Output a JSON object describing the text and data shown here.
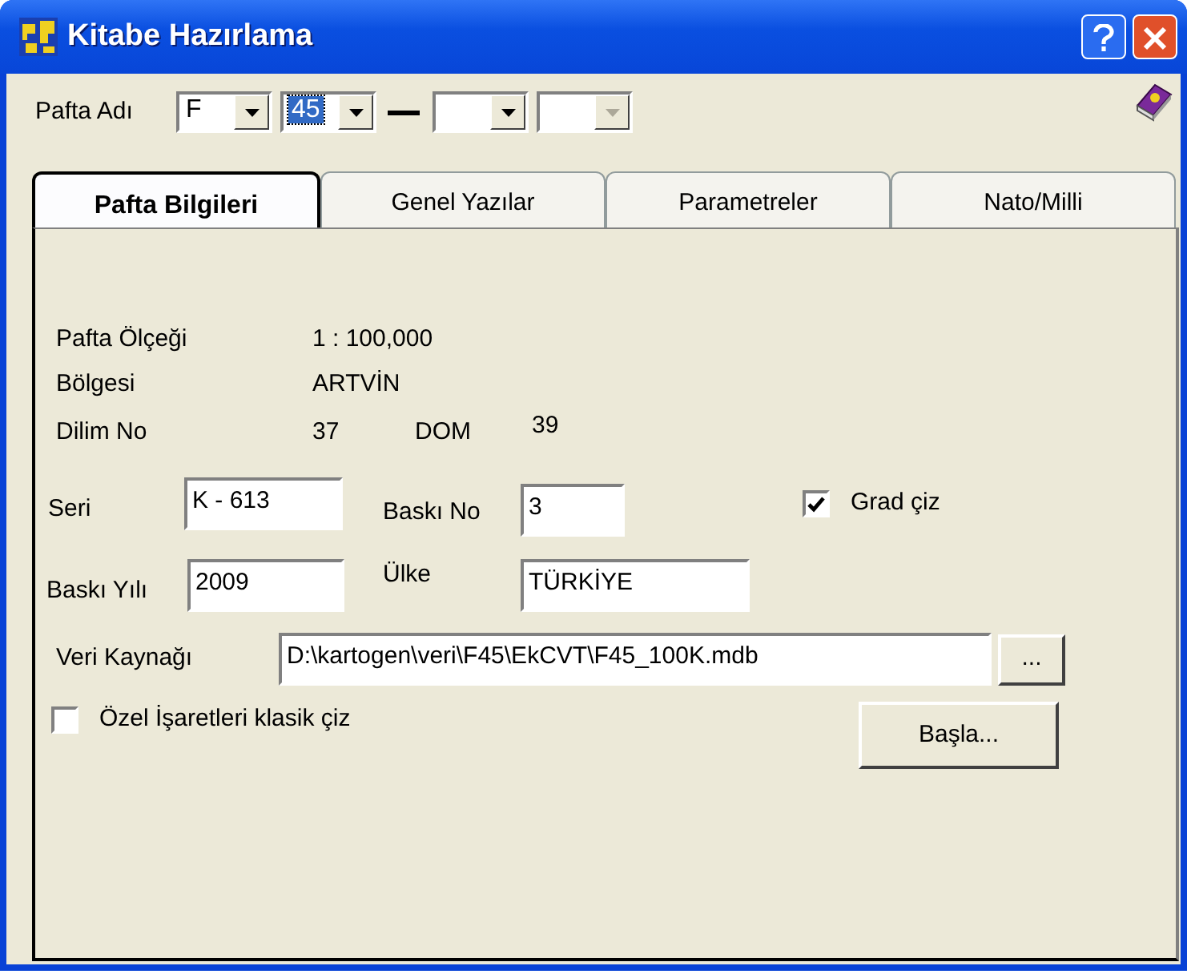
{
  "window": {
    "title": "Kitabe Hazırlama"
  },
  "pafta_adi": {
    "label": "Pafta Adı",
    "combos": [
      {
        "value": "F",
        "focused": false,
        "disabled": false
      },
      {
        "value": "45",
        "focused": true,
        "disabled": false
      },
      {
        "focused": false,
        "disabled": false
      },
      {
        "focused": false,
        "disabled": true
      }
    ]
  },
  "tabs": [
    {
      "label": "Pafta Bilgileri",
      "selected": true
    },
    {
      "label": "Genel Yazılar",
      "selected": false
    },
    {
      "label": "Parametreler",
      "selected": false
    },
    {
      "label": "Nato/Milli",
      "selected": false
    }
  ],
  "info": [
    {
      "label": "Pafta Ölçeği",
      "value": "1 : 100,000"
    },
    {
      "label": "Bölgesi",
      "value": "ARTVİN"
    },
    {
      "label": "Dilim No",
      "value": "37",
      "extra_label": "DOM",
      "extra_value": "39"
    }
  ],
  "seri": {
    "label": "Seri",
    "value": "K - 613"
  },
  "baski_no": {
    "label": "Baskı No",
    "value": "3"
  },
  "grad_ciz": {
    "label": "Grad çiz",
    "checked": true
  },
  "baski_yili": {
    "label": "Baskı Yılı",
    "value": "2009"
  },
  "ulke": {
    "label": "Ülke",
    "value": "TÜRKİYE"
  },
  "veri_kaynagi": {
    "label": "Veri Kaynağı",
    "value": "D:\\kartogen\\veri\\F45\\EkCVT\\F45_100K.mdb",
    "browse_button": "..."
  },
  "ozel_isaretler": {
    "label": "Özel İşaretleri klasik çiz",
    "checked": false
  },
  "start_button": "Başla..."
}
